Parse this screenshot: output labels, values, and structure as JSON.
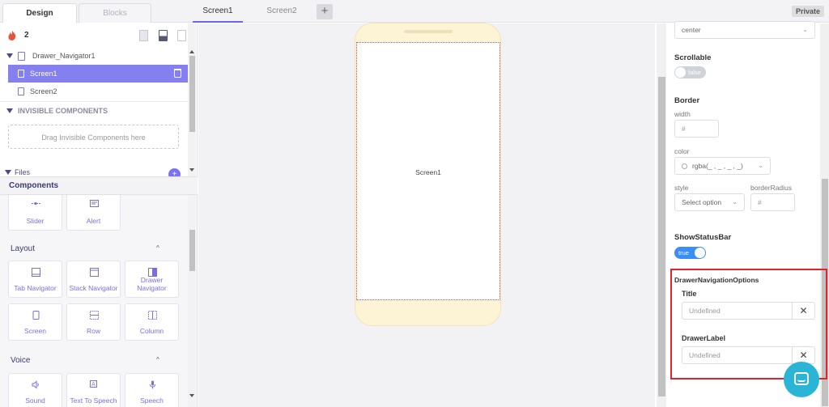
{
  "topbar": {
    "design_tab": "Design",
    "blocks_tab": "Blocks",
    "screen_tabs": [
      "Screen1",
      "Screen2"
    ],
    "add_screen": "+",
    "privacy_badge": "Private"
  },
  "project": {
    "count": "2"
  },
  "tree": {
    "navigator": "Drawer_Navigator1",
    "screens": [
      "Screen1",
      "Screen2"
    ],
    "invisible_header": "INVISIBLE COMPONENTS",
    "dropzone": "Drag Invisible Components here",
    "files": "Files"
  },
  "components": {
    "header": "Components",
    "top_cards": [
      "Slider",
      "Alert"
    ],
    "layout_header": "Layout",
    "layout_cards": [
      "Tab Navigator",
      "Stack Navigator",
      "Drawer Navigator",
      "Screen",
      "Row",
      "Column"
    ],
    "voice_header": "Voice",
    "voice_cards": [
      "Sound",
      "Text To Speech",
      "Speech"
    ],
    "collapse_chevron": "^"
  },
  "canvas": {
    "screen_label": "Screen1"
  },
  "properties": {
    "align_value": "center",
    "scrollable_title": "Scrollable",
    "scrollable_value": "false",
    "border_title": "Border",
    "width_label": "width",
    "width_placeholder": "#",
    "color_label": "color",
    "color_value": "rgba(_ , _ , _ , _)",
    "style_label": "style",
    "style_placeholder": "Select option",
    "radius_label": "borderRadius",
    "radius_placeholder": "#",
    "statusbar_title": "ShowStatusBar",
    "statusbar_value": "true",
    "drawer_options_title": "DrawerNavigationOptions",
    "title_label": "Title",
    "title_placeholder": "Undefined",
    "drawer_label": "DrawerLabel",
    "drawer_label_placeholder": "Undefined",
    "clear_glyph": "✕"
  },
  "colors": {
    "accent": "#6c63ff",
    "selected_row": "#8580f0",
    "highlight": "#e0242b",
    "toggle_on": "#3a8ef6",
    "chat": "#2ab4d6"
  }
}
